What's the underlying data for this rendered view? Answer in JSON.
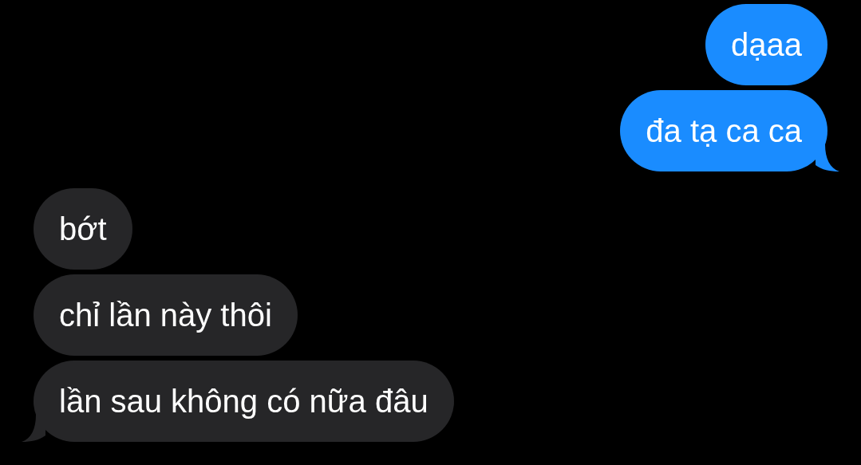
{
  "messages": [
    {
      "text": "dạaa",
      "kind": "sent",
      "tail": false
    },
    {
      "text": "đa tạ ca ca",
      "kind": "sent",
      "tail": true
    },
    {
      "text": "bớt",
      "kind": "received",
      "tail": false
    },
    {
      "text": "chỉ lần này thôi",
      "kind": "received",
      "tail": false
    },
    {
      "text": "lần sau không có nữa đâu",
      "kind": "received",
      "tail": true
    }
  ]
}
